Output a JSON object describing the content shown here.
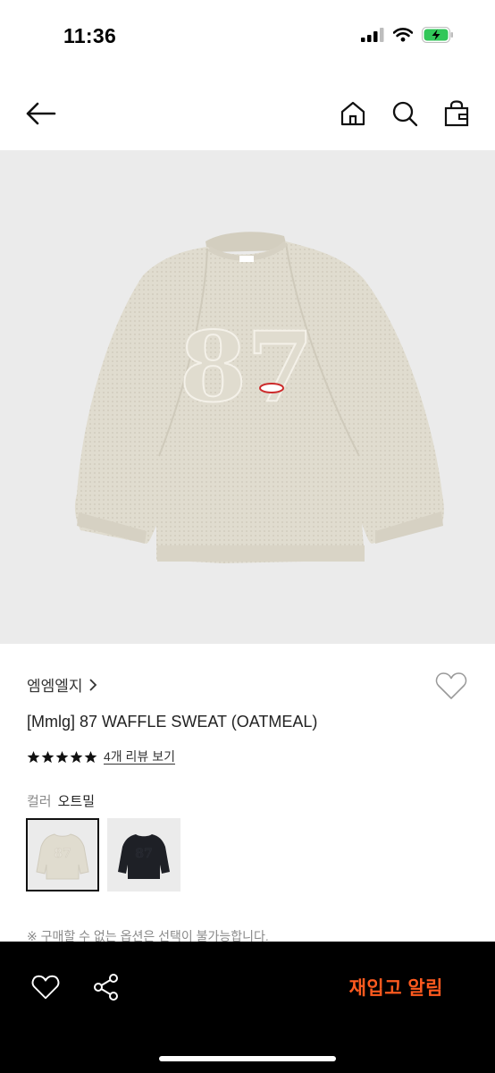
{
  "status_bar": {
    "time": "11:36"
  },
  "product": {
    "brand": "엠엠엘지",
    "title": "[Mmlg] 87 WAFFLE SWEAT (OATMEAL)",
    "rating_stars": 5,
    "review_link": "4개 리뷰 보기",
    "color_label": "컬러",
    "color_value": "오트밀",
    "swatches": [
      "oatmeal",
      "black"
    ],
    "graphic_number": "87",
    "notice": "※ 구매할 수 없는 옵션은 선택이 불가능합니다."
  },
  "bottom_bar": {
    "restock_label": "재입고 알림"
  },
  "colors": {
    "accent": "#ff5a1f",
    "oatmeal": "#e0dccf",
    "black": "#1e2026"
  }
}
